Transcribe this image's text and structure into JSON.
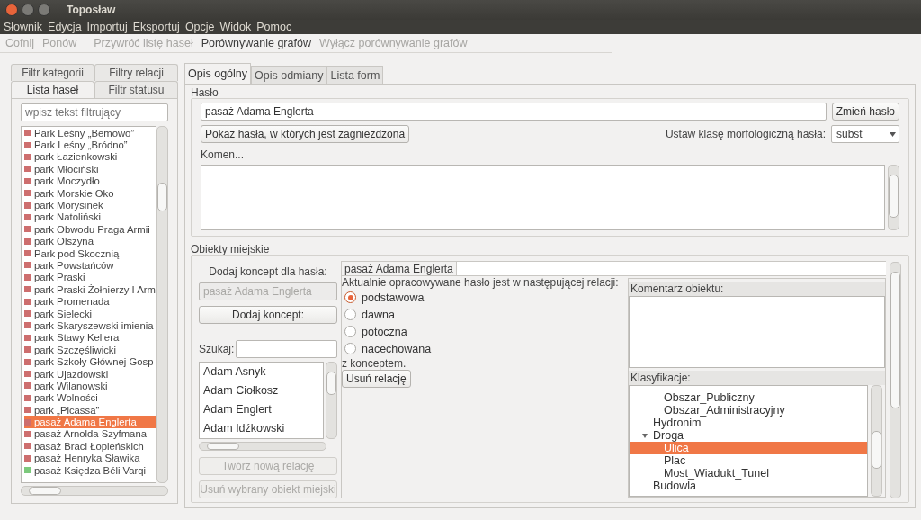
{
  "window": {
    "title": "Toposław"
  },
  "menu": [
    "Słownik",
    "Edycja",
    "Importuj",
    "Eksportuj",
    "Opcje",
    "Widok",
    "Pomoc"
  ],
  "toolbar": [
    {
      "kind": "action",
      "label": "Cofnij",
      "disabled": true
    },
    {
      "kind": "action",
      "label": "Ponów",
      "disabled": true
    },
    {
      "kind": "separator"
    },
    {
      "kind": "action",
      "label": "Przywróć listę haseł",
      "disabled": true
    },
    {
      "kind": "action",
      "label": "Porównywanie grafów",
      "disabled": false
    },
    {
      "kind": "action",
      "label": "Wyłącz porównywanie grafów",
      "disabled": true
    }
  ],
  "left_panel": {
    "tabs_back": [
      {
        "label": "Filtr kategorii",
        "selected": false
      },
      {
        "label": "Filtry relacji",
        "selected": false
      }
    ],
    "tabs_front": [
      {
        "label": "Lista haseł",
        "selected": true
      },
      {
        "label": "Filtr statusu",
        "selected": false
      }
    ],
    "filter": {
      "placeholder": "wpisz tekst filtrujący"
    },
    "entries": [
      {
        "label": "Park Leśny „Bemowo”",
        "color": "#cd6e6e",
        "selected": false
      },
      {
        "label": "Park Leśny „Bródno”",
        "color": "#cd6e6e",
        "selected": false
      },
      {
        "label": "park Łazienkowski",
        "color": "#cd6e6e",
        "selected": false
      },
      {
        "label": "park Młociński",
        "color": "#cd6e6e",
        "selected": false
      },
      {
        "label": "park Moczydło",
        "color": "#cd6e6e",
        "selected": false
      },
      {
        "label": "park Morskie Oko",
        "color": "#cd6e6e",
        "selected": false
      },
      {
        "label": "park Morysinek",
        "color": "#cd6e6e",
        "selected": false
      },
      {
        "label": "park Natoliński",
        "color": "#cd6e6e",
        "selected": false
      },
      {
        "label": "park Obwodu Praga Armii",
        "color": "#cd6e6e",
        "selected": false
      },
      {
        "label": "park Olszyna",
        "color": "#cd6e6e",
        "selected": false
      },
      {
        "label": "Park pod Skocznią",
        "color": "#cd6e6e",
        "selected": false
      },
      {
        "label": "park Powstańców",
        "color": "#cd6e6e",
        "selected": false
      },
      {
        "label": "park Praski",
        "color": "#cd6e6e",
        "selected": false
      },
      {
        "label": "park Praski Żołnierzy I Arm",
        "color": "#cd6e6e",
        "selected": false
      },
      {
        "label": "park Promenada",
        "color": "#cd6e6e",
        "selected": false
      },
      {
        "label": "park Sielecki",
        "color": "#cd6e6e",
        "selected": false
      },
      {
        "label": "park Skaryszewski imienia",
        "color": "#cd6e6e",
        "selected": false
      },
      {
        "label": "park Stawy Kellera",
        "color": "#cd6e6e",
        "selected": false
      },
      {
        "label": "park Szczęśliwicki",
        "color": "#cd6e6e",
        "selected": false
      },
      {
        "label": "park Szkoły Głównej Gosp",
        "color": "#cd6e6e",
        "selected": false
      },
      {
        "label": "park Ujazdowski",
        "color": "#cd6e6e",
        "selected": false
      },
      {
        "label": "park Wilanowski",
        "color": "#cd6e6e",
        "selected": false
      },
      {
        "label": "park Wolności",
        "color": "#cd6e6e",
        "selected": false
      },
      {
        "label": "park „Picassa”",
        "color": "#cd6e6e",
        "selected": false
      },
      {
        "label": "pasaż Adama Englerta",
        "color": "#cd6e6e",
        "selected": true
      },
      {
        "label": "pasaż Arnolda Szyfmana",
        "color": "#cd6e6e",
        "selected": false
      },
      {
        "label": "pasaż Braci Łopieńskich",
        "color": "#cd6e6e",
        "selected": false
      },
      {
        "label": "pasaż Henryka Sławika",
        "color": "#cd6e6e",
        "selected": false
      },
      {
        "label": "pasaż Księdza Béli Varqi",
        "color": "#7cc97c",
        "selected": false
      }
    ]
  },
  "tabs": [
    {
      "label": "Opis ogólny",
      "selected": true
    },
    {
      "label": "Opis odmiany",
      "selected": false
    },
    {
      "label": "Lista form",
      "selected": false
    }
  ],
  "haslo": {
    "title": "Hasło",
    "value": "pasaż Adama Englerta",
    "change_button": "Zmień hasło",
    "nested_button": "Pokaż hasła, w których jest zagnieżdżona",
    "class_label": "Ustaw klasę morfologiczną hasła:",
    "class_value": "subst",
    "comment_label": "Komen..."
  },
  "objects": {
    "title": "Obiekty miejskie",
    "add_label": "Dodaj koncept dla hasła:",
    "add_field": "pasaż Adama Englerta",
    "add_button": "Dodaj koncept:",
    "search_label": "Szukaj:",
    "concepts": [
      "Adam Asnyk",
      "Adam Ciołkosz",
      "Adam Englert",
      "Adam Idźkowski"
    ],
    "create_button": "Twórz nową relację",
    "delete_button": "Usuń wybrany obiekt miejski",
    "relation_tab": "pasaż Adama Englerta",
    "relation_text": "Aktualnie opracowywane hasło jest w następującej relacji:",
    "relations": [
      {
        "label": "podstawowa",
        "selected": true
      },
      {
        "label": "dawna",
        "selected": false
      },
      {
        "label": "potoczna",
        "selected": false
      },
      {
        "label": "nacechowana",
        "selected": false
      }
    ],
    "relation_suffix": "z konceptem.",
    "remove_relation_button": "Usuń relację",
    "comment_header": "Komentarz obiektu:",
    "classification_header": "Klasyfikacje:",
    "classifications": [
      {
        "children": [
          {
            "label": "Obszar_Publiczny",
            "selected": false
          },
          {
            "label": "Obszar_Administracyjny",
            "selected": false
          }
        ]
      },
      {
        "label": "Hydronim",
        "selected": false
      },
      {
        "label": "Droga",
        "selected": false,
        "expanded": true,
        "children": [
          {
            "label": "Ulica",
            "selected": true
          },
          {
            "label": "Plac",
            "selected": false
          },
          {
            "label": "Most_Wiadukt_Tunel",
            "selected": false
          }
        ]
      },
      {
        "label": "Budowla",
        "selected": false
      }
    ]
  }
}
